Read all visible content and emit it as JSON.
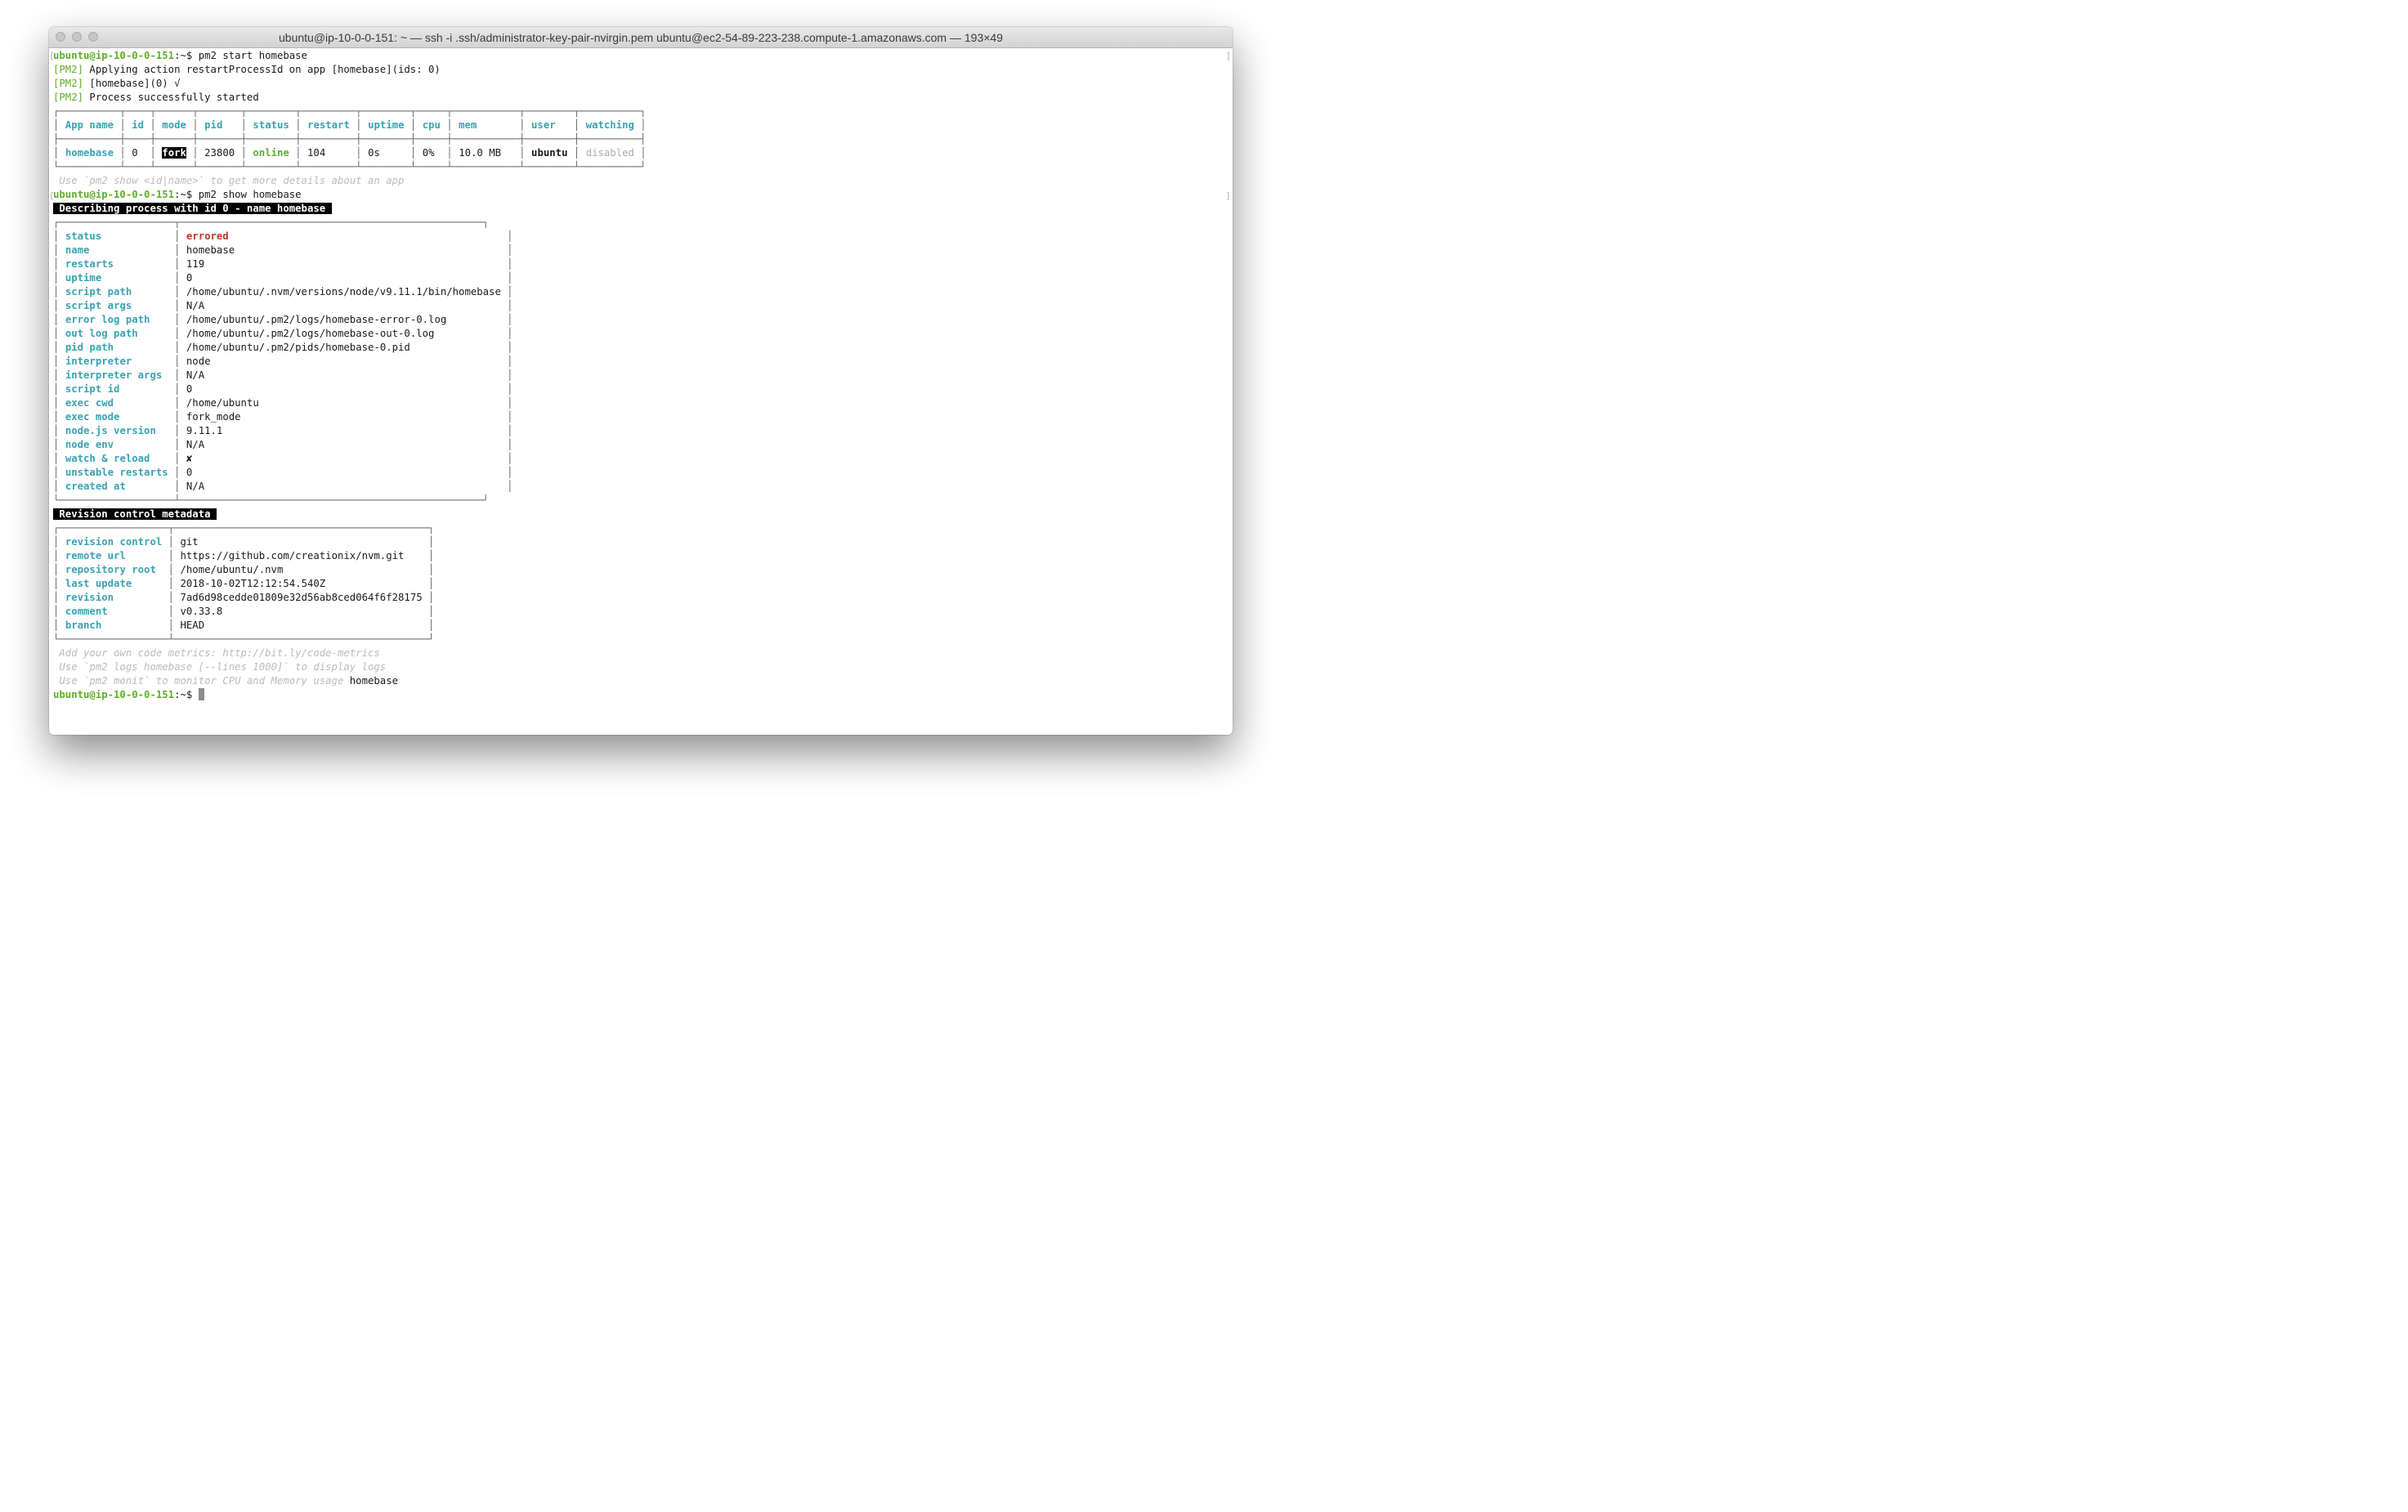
{
  "window": {
    "title": "ubuntu@ip-10-0-0-151: ~ — ssh -i .ssh/administrator-key-pair-nvirgin.pem ubuntu@ec2-54-89-223-238.compute-1.amazonaws.com — 193×49"
  },
  "prompt": {
    "userhost": "ubuntu@ip-10-0-0-151",
    "path_suffix": ":~$ "
  },
  "cmd1": "pm2 start homebase",
  "pm2_tag": "[PM2]",
  "log": {
    "l1": " Applying action restartProcessId on app [homebase](ids: 0)",
    "l2": " [homebase](0) √",
    "l3": " Process successfully started"
  },
  "list_table": {
    "border_top": "┌──────────┬────┬──────┬───────┬────────┬─────────┬────────┬─────┬───────────┬────────┬──────────┐",
    "border_mid": "├──────────┼────┼──────┼───────┼────────┼─────────┼────────┼─────┼───────────┼────────┼──────────┤",
    "border_bottom": "└──────────┴────┴──────┴───────┴────────┴─────────┴────────┴─────┴───────────┴────────┴──────────┘",
    "headers": {
      "app_name": "App name",
      "id": "id",
      "mode": "mode",
      "pid": "pid",
      "status": "status",
      "restart": "restart",
      "uptime": "uptime",
      "cpu": "cpu",
      "mem": "mem",
      "user": "user",
      "watching": "watching"
    },
    "row": {
      "app_name": "homebase",
      "id": "0",
      "mode": "fork",
      "pid": "23800",
      "status": "online",
      "restart": "104",
      "uptime": "0s",
      "cpu": "0%",
      "mem": "10.0 MB",
      "user": "ubuntu",
      "watching": "disabled"
    }
  },
  "hint_show": " Use `pm2 show <id|name>` to get more details about an app",
  "cmd2": "pm2 show homebase",
  "describe_header": " Describing process with id 0 - name homebase ",
  "describe_table": {
    "border_top": "┌───────────────────┬──────────────────────────────────────────────────┐",
    "border_bottom": "└───────────────────┴──────────────────────────────────────────────────┘",
    "rows": [
      {
        "key": "status",
        "value": "errored"
      },
      {
        "key": "name",
        "value": "homebase"
      },
      {
        "key": "restarts",
        "value": "119"
      },
      {
        "key": "uptime",
        "value": "0"
      },
      {
        "key": "script path",
        "value": "/home/ubuntu/.nvm/versions/node/v9.11.1/bin/homebase"
      },
      {
        "key": "script args",
        "value": "N/A"
      },
      {
        "key": "error log path",
        "value": "/home/ubuntu/.pm2/logs/homebase-error-0.log"
      },
      {
        "key": "out log path",
        "value": "/home/ubuntu/.pm2/logs/homebase-out-0.log"
      },
      {
        "key": "pid path",
        "value": "/home/ubuntu/.pm2/pids/homebase-0.pid"
      },
      {
        "key": "interpreter",
        "value": "node"
      },
      {
        "key": "interpreter args",
        "value": "N/A"
      },
      {
        "key": "script id",
        "value": "0"
      },
      {
        "key": "exec cwd",
        "value": "/home/ubuntu"
      },
      {
        "key": "exec mode",
        "value": "fork_mode"
      },
      {
        "key": "node.js version",
        "value": "9.11.1"
      },
      {
        "key": "node env",
        "value": "N/A"
      },
      {
        "key": "watch & reload",
        "value": "✘"
      },
      {
        "key": "unstable restarts",
        "value": "0"
      },
      {
        "key": "created at",
        "value": "N/A"
      }
    ]
  },
  "revision_header": " Revision control metadata ",
  "revision_table": {
    "border_top": "┌──────────────────┬──────────────────────────────────────────┐",
    "border_bottom": "└──────────────────┴──────────────────────────────────────────┘",
    "rows": [
      {
        "key": "revision control",
        "value": "git"
      },
      {
        "key": "remote url",
        "value": "https://github.com/creationix/nvm.git"
      },
      {
        "key": "repository root",
        "value": "/home/ubuntu/.nvm"
      },
      {
        "key": "last update",
        "value": "2018-10-02T12:12:54.540Z"
      },
      {
        "key": "revision",
        "value": "7ad6d98cedde01809e32d56ab8ced064f6f28175"
      },
      {
        "key": "comment",
        "value": "v0.33.8"
      },
      {
        "key": "branch",
        "value": "HEAD"
      }
    ]
  },
  "tips": {
    "t1": " Add your own code metrics: http://bit.ly/code-metrics",
    "t2": " Use `pm2 logs homebase [--lines 1000]` to display logs",
    "t3": " Use `pm2 monit` to monitor CPU and Memory usage",
    "t3_suffix": " homebase"
  },
  "colors": {
    "prompt_green": "#5faf27",
    "key_cyan": "#3aa3b3",
    "errored_red": "#b83a2a",
    "hint_gray": "#bbbbbb"
  }
}
